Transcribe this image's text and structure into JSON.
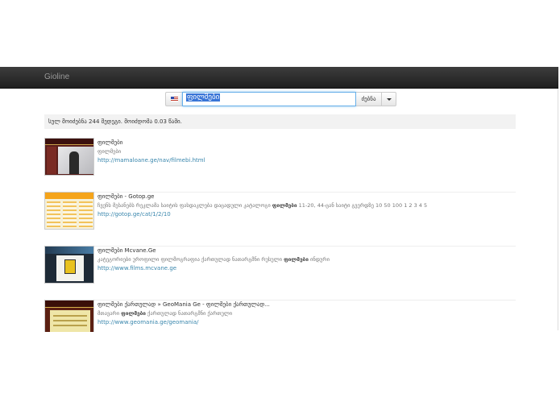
{
  "navbar": {
    "brand": "Gioline"
  },
  "search": {
    "query": "ფილმები",
    "submit_label": "ძებნა",
    "language_flag": "us-flag-icon"
  },
  "stats": {
    "text": "სულ მოიძებნა 244 შედეგი. მოიძდომა 0.03 წამი."
  },
  "results": [
    {
      "title": "ფილმები",
      "snippet": "ფილმები",
      "snippet_bold": "",
      "snippet_tail": "",
      "url": "http://mamaloane.ge/nav/filmebi.html"
    },
    {
      "title": "ფილმები - Gotop.ge",
      "snippet": "ჩვენს მესანებს რეკლამა საიტის ფასდაკლება დაცადული კატალოგი",
      "snippet_bold": "ფილმები",
      "snippet_tail": "11-20, 44-ცან საიტი გვერდზე 10 50 100 1 2 3 4 5",
      "url": "http://gotop.ge/cat/1/2/10"
    },
    {
      "title": "ფილმები Mcvane.Ge",
      "snippet": "კატეგორიები უროფილი ფილმოგრაფია ქართულად ნათარგმნი რუსული",
      "snippet_bold": "ფილმები",
      "snippet_tail": "ინდური",
      "url": "http://www.films.mcvane.ge"
    },
    {
      "title": "ფილმები ქართულად » GeoMania Ge - ფილმები ქართულად...",
      "snippet": "მთავარი",
      "snippet_bold": "ფილმები",
      "snippet_tail": "ქართულად ნათარგმნი ქართული",
      "url": "http://www.geomania.ge/geomania/"
    }
  ]
}
